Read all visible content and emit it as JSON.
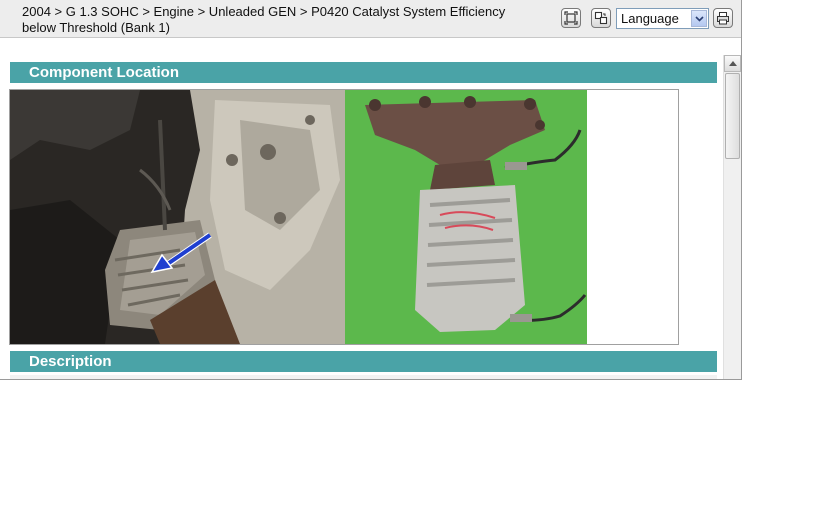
{
  "header": {
    "breadcrumb": "2004 > G 1.3 SOHC > Engine > Unleaded GEN > P0420 Catalyst System Efficiency below Threshold (Bank 1)",
    "toolbar": {
      "language_value": "Language",
      "language_options": [
        "Language"
      ]
    }
  },
  "sections": {
    "component_location": "Component Location",
    "description": "Description"
  },
  "icons": {
    "toolbar": [
      "expand-window-icon",
      "split-view-icon",
      "chevron-down-icon",
      "printer-icon"
    ],
    "scrollbar": [
      "scroll-up-arrow-icon"
    ]
  },
  "colors": {
    "section_header": "#4aa3a7",
    "arrow": "#1f3fd0",
    "photo_green": "#5cb84c"
  }
}
